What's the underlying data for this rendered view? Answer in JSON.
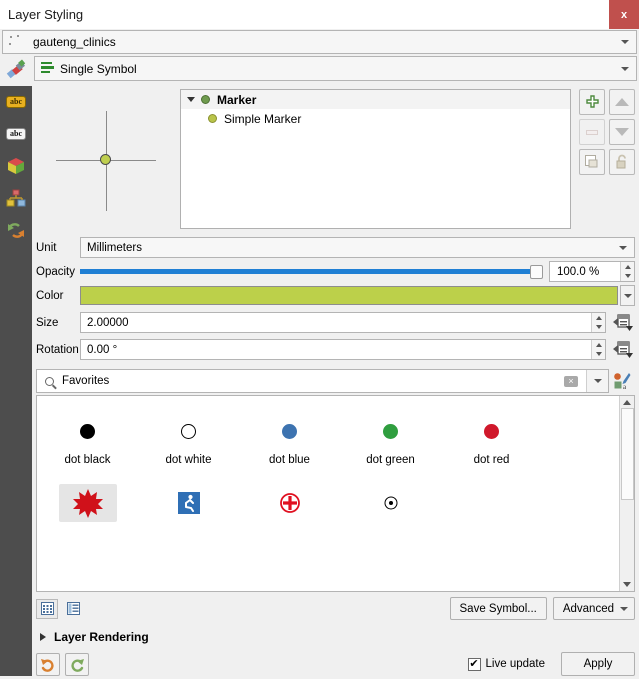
{
  "window": {
    "title": "Layer Styling",
    "close_label": "x"
  },
  "layer_selector": {
    "value": "gauteng_clinics",
    "icon": "point-layer-icon"
  },
  "renderer": {
    "value": "Single Symbol",
    "icon": "single-symbol-icon"
  },
  "preview": {
    "symbol_color": "#bfcf4f"
  },
  "symbol_tree": {
    "nodes": [
      {
        "label": "Marker",
        "bold": true,
        "dot_color": "#6f9b4e"
      },
      {
        "label": "Simple Marker",
        "bold": false,
        "dot_color": "#b9c44a"
      }
    ],
    "buttons": [
      {
        "name": "add-symbol-layer",
        "icon": "plus-icon"
      },
      {
        "name": "move-up",
        "icon": "triangle-up-icon"
      },
      {
        "name": "remove-symbol-layer",
        "icon": "minus-icon"
      },
      {
        "name": "move-down",
        "icon": "triangle-down-icon"
      },
      {
        "name": "duplicate-symbol-layer",
        "icon": "duplicate-icon"
      },
      {
        "name": "lock-layer",
        "icon": "unlock-icon"
      }
    ]
  },
  "properties": {
    "unit": {
      "label": "Unit",
      "value": "Millimeters"
    },
    "opacity": {
      "label": "Opacity",
      "value": "100.0 %",
      "percent": 100
    },
    "color": {
      "label": "Color",
      "value": "#bcd04a"
    },
    "size": {
      "label": "Size",
      "value": "2.00000"
    },
    "rotation": {
      "label": "Rotation",
      "value": "0.00 °"
    }
  },
  "search": {
    "placeholder": "Favorites",
    "value": "Favorites",
    "clear_label": "×",
    "icons": {
      "search": "search-icon",
      "clear": "clear-icon",
      "dropdown": "chevron-down-icon",
      "style_manager": "style-manager-icon"
    }
  },
  "symbol_gallery": {
    "row1": [
      {
        "label": "dot  black",
        "color": "#000000",
        "style": "filled"
      },
      {
        "label": "dot  white",
        "color": "#ffffff",
        "style": "outlined"
      },
      {
        "label": "dot blue",
        "color": "#3d73b0",
        "style": "filled"
      },
      {
        "label": "dot green",
        "color": "#2f9e3f",
        "style": "filled"
      },
      {
        "label": "dot red",
        "color": "#d0182b",
        "style": "filled"
      }
    ],
    "row2": [
      {
        "label": "",
        "icon": "starburst-icon",
        "color": "#e8141e",
        "selected": true
      },
      {
        "label": "",
        "icon": "accessibility-icon",
        "color": "#2f6fb5",
        "selected": false
      },
      {
        "label": "",
        "icon": "medical-cross-icon",
        "color": "#e01020",
        "selected": false
      },
      {
        "label": "",
        "icon": "dot-in-circle-icon",
        "color": "#000000",
        "selected": false
      }
    ]
  },
  "view_toggles": {
    "grid": "grid-view-icon",
    "list": "list-view-icon"
  },
  "buttons": {
    "save_symbol": "Save Symbol...",
    "advanced": "Advanced"
  },
  "layer_rendering": {
    "label": "Layer Rendering"
  },
  "footer": {
    "undo": "undo-icon",
    "redo": "redo-icon",
    "live_update_label": "Live update",
    "live_update_checked": true,
    "check_glyph": "✔",
    "apply_label": "Apply"
  }
}
